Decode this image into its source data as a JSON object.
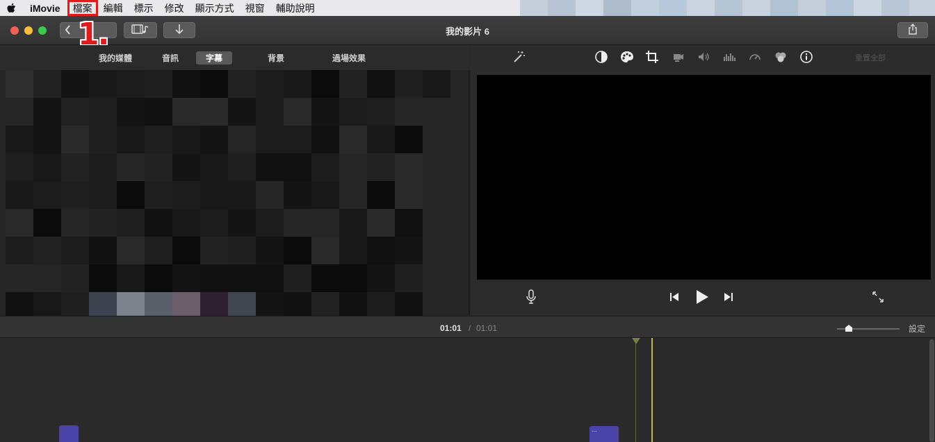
{
  "menubar": {
    "app_name": "iMovie",
    "items": [
      "檔案",
      "編輯",
      "標示",
      "修改",
      "顯示方式",
      "視窗",
      "輔助說明"
    ]
  },
  "annotation": {
    "label": "1."
  },
  "window": {
    "title": "我的影片 6"
  },
  "browser": {
    "tabs": [
      "我的媒體",
      "音訊",
      "字幕",
      "背景",
      "過場效果"
    ],
    "active_tab": "字幕"
  },
  "viewer": {
    "tool_icons": [
      "magic-wand-icon",
      "color-balance-icon",
      "color-correction-icon",
      "crop-icon",
      "stabilization-icon",
      "volume-icon",
      "noise-reduction-icon",
      "speed-icon",
      "clip-filter-icon",
      "info-icon"
    ],
    "reset_all": "重置全部"
  },
  "timeline": {
    "current_time": "01:01",
    "separator": "/",
    "total_time": "01:01",
    "settings_label": "設定",
    "clip_label": "..."
  },
  "colors": {
    "annotation_red": "#e01b1b",
    "playhead": "#c9b13b",
    "clip": "#4b44a8"
  }
}
